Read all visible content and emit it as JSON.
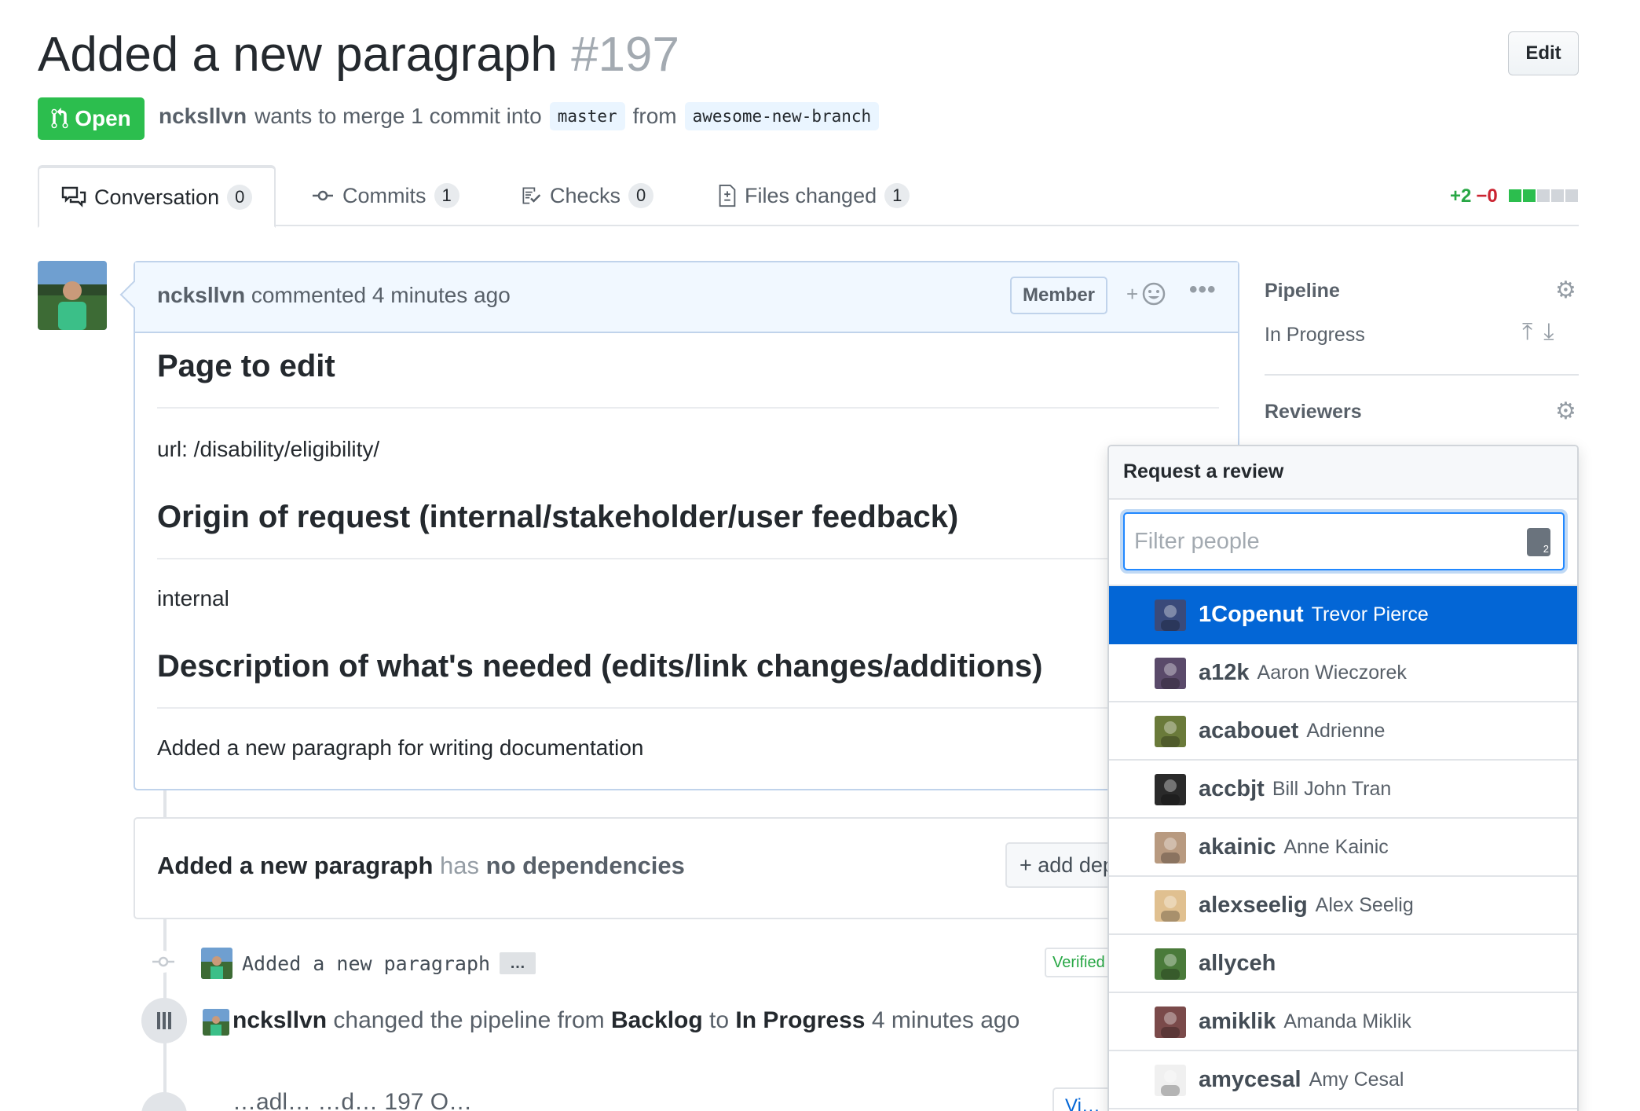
{
  "header": {
    "title": "Added a new paragraph",
    "number": "#197",
    "edit_label": "Edit",
    "state": "Open",
    "author": "ncksllvn",
    "merge_text": "wants to merge 1 commit into",
    "base_branch": "master",
    "from_text": "from",
    "head_branch": "awesome-new-branch"
  },
  "tabs": [
    {
      "label": "Conversation",
      "count": "0"
    },
    {
      "label": "Commits",
      "count": "1"
    },
    {
      "label": "Checks",
      "count": "0"
    },
    {
      "label": "Files changed",
      "count": "1"
    }
  ],
  "diffstat": {
    "additions": "+2",
    "deletions": "−0"
  },
  "comment": {
    "author": "ncksllvn",
    "action": "commented 4 minutes ago",
    "badge": "Member",
    "react_plus": "+",
    "more": "•••",
    "h1": "Page to edit",
    "p1": "url: /disability/eligibility/",
    "h2": "Origin of request (internal/stakeholder/user feedback)",
    "p2": "internal",
    "h3": "Description of what's needed (edits/link changes/additions)",
    "p3": "Added a new paragraph for writing documentation"
  },
  "dependencies": {
    "title": "Added a new paragraph",
    "has": "has",
    "none": "no dependencies",
    "add_button": "+ add dep"
  },
  "commit": {
    "message": "Added a new paragraph",
    "ellipsis": "…",
    "verified": "Verified"
  },
  "pipeline_event": {
    "actor": "ncksllvn",
    "text1": "changed the pipeline from",
    "from": "Backlog",
    "to_word": "to",
    "to": "In Progress",
    "time": "4 minutes ago"
  },
  "bottom_event": {
    "text": "…adl… …d… 197 O…",
    "view_label": "Vi…"
  },
  "sidebar": {
    "pipeline_title": "Pipeline",
    "pipeline_value": "In Progress",
    "reviewers_title": "Reviewers"
  },
  "review_dropdown": {
    "title": "Request a review",
    "filter_placeholder": "Filter people",
    "kbd_hint": "2",
    "people": [
      {
        "login": "1Copenut",
        "name": "Trevor Pierce",
        "color": "#3a4a7a"
      },
      {
        "login": "a12k",
        "name": "Aaron Wieczorek",
        "color": "#5a4a6a"
      },
      {
        "login": "acabouet",
        "name": "Adrienne",
        "color": "#6a7a3a"
      },
      {
        "login": "accbjt",
        "name": "Bill John Tran",
        "color": "#2a2a2a"
      },
      {
        "login": "akainic",
        "name": "Anne Kainic",
        "color": "#b89a80"
      },
      {
        "login": "alexseelig",
        "name": "Alex Seelig",
        "color": "#e0c090"
      },
      {
        "login": "allyceh",
        "name": "",
        "color": "#4a7a3a"
      },
      {
        "login": "amiklik",
        "name": "Amanda Miklik",
        "color": "#7a4a4a"
      },
      {
        "login": "amycesal",
        "name": "Amy Cesal",
        "color": "#f0f0f0"
      }
    ]
  },
  "colors": {
    "open_green": "#2cbe4e",
    "selected_blue": "#0366d6",
    "link_blue": "#0366d6"
  }
}
